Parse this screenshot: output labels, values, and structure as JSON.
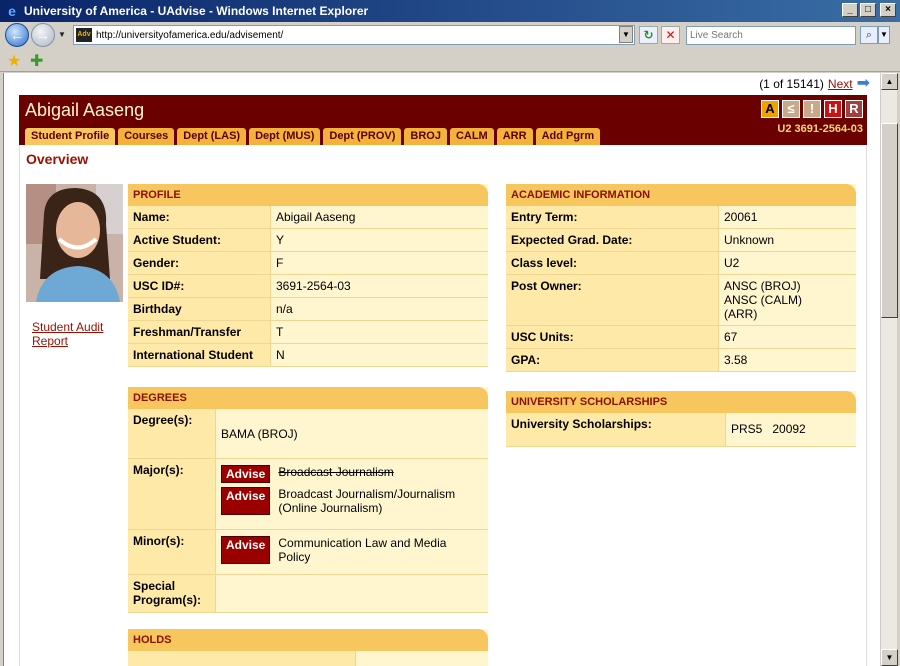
{
  "window": {
    "title": "University of America - UAdvise - Windows Internet Explorer",
    "ie_icon": "e",
    "minimize": "_",
    "maximize": "□",
    "close": "×"
  },
  "toolbar": {
    "address": "http://universityofamerica.edu/advisement/",
    "favicon_text": "Adv",
    "search_placeholder": "Live Search"
  },
  "pager": {
    "text": "(1 of 15141)",
    "next": "Next"
  },
  "student": {
    "name": "Abigail Aaseng",
    "id_line": "U2 3691-2564-03",
    "badges": [
      "A",
      "≤",
      "!",
      "H",
      "R"
    ]
  },
  "tabs": [
    "Student Profile",
    "Courses",
    "Dept (LAS)",
    "Dept (MUS)",
    "Dept (PROV)",
    "BROJ",
    "CALM",
    "ARR",
    "Add Pgrm"
  ],
  "overview_title": "Overview",
  "audit_link": "Student Audit Report",
  "profile": {
    "heading": "PROFILE",
    "rows": [
      {
        "k": "Name:",
        "v": "Abigail Aaseng"
      },
      {
        "k": "Active Student:",
        "v": "Y"
      },
      {
        "k": "Gender:",
        "v": "F"
      },
      {
        "k": "USC ID#:",
        "v": "3691-2564-03"
      },
      {
        "k": "Birthday",
        "v": "n/a"
      },
      {
        "k": "Freshman/Transfer",
        "v": "T"
      },
      {
        "k": "International Student",
        "v": "N"
      }
    ]
  },
  "academic": {
    "heading": "ACADEMIC INFORMATION",
    "rows": [
      {
        "k": "Entry Term:",
        "v": "20061"
      },
      {
        "k": "Expected Grad. Date:",
        "v": "Unknown"
      },
      {
        "k": "Class level:",
        "v": "U2"
      },
      {
        "k": "Post Owner:",
        "v": "ANSC (BROJ)",
        "v2": "ANSC (CALM)",
        "v3": "(ARR)"
      },
      {
        "k": "USC Units:",
        "v": "67"
      },
      {
        "k": "GPA:",
        "v": "3.58"
      }
    ]
  },
  "degrees": {
    "heading": "DEGREES",
    "degree_label": "Degree(s):",
    "degree_value": "BAMA (BROJ)",
    "major_label": "Major(s):",
    "majors": [
      {
        "button": "Advise",
        "text": "Broadcast Journalism",
        "struck": true
      },
      {
        "button": "Advise",
        "text": "Broadcast Journalism/Journalism (Online Journalism)",
        "struck": false
      }
    ],
    "minor_label": "Minor(s):",
    "minors": [
      {
        "button": "Advise",
        "text": "Communication Law and Media Policy"
      }
    ],
    "special_label": "Special Program(s):"
  },
  "scholarships": {
    "heading": "UNIVERSITY SCHOLARSHIPS",
    "label": "University Scholarships:",
    "value": "PRS5   20092"
  },
  "holds": {
    "heading": "HOLDS"
  }
}
